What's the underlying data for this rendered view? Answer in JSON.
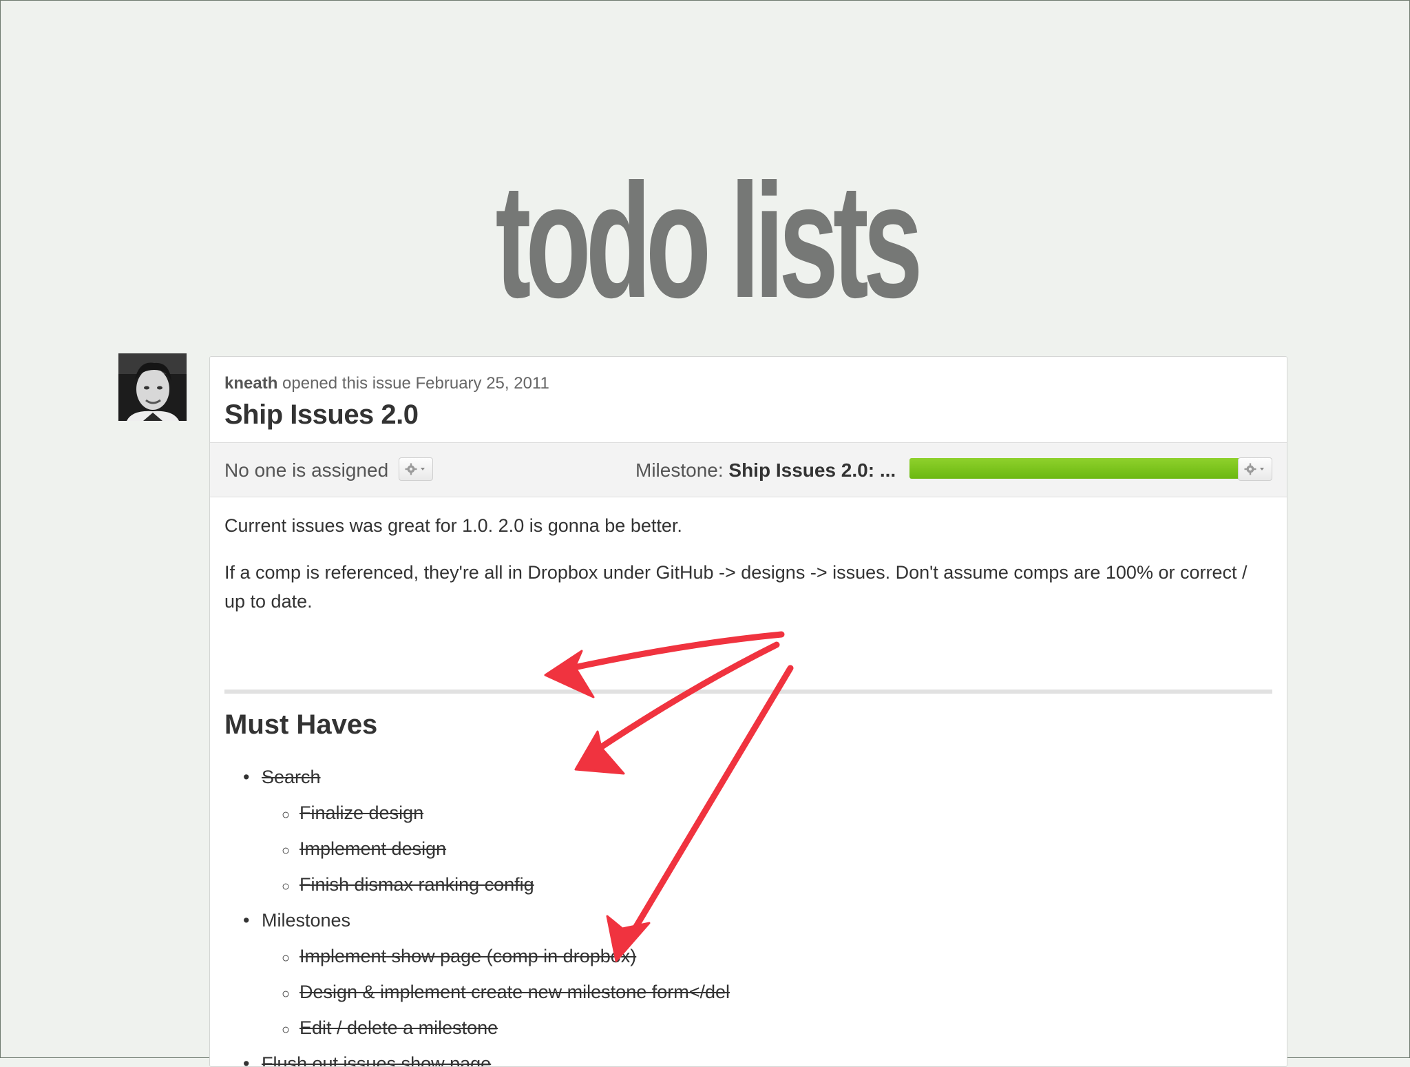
{
  "slide": {
    "title": "todo lists"
  },
  "issue": {
    "author": "kneath",
    "byline_rest": "opened this issue February 25, 2011",
    "title": "Ship Issues 2.0",
    "assignee_text": "No one is assigned",
    "milestone_prefix": "Milestone:",
    "milestone_name": "Ship Issues 2.0: ...",
    "milestone_progress": 1.0,
    "body_paragraph_1": "Current issues was great for 1.0. 2.0 is gonna be better.",
    "body_paragraph_2": "If a comp is referenced, they're all in Dropbox under GitHub -> designs -> issues. Don't assume comps are 100% or correct / up to date.",
    "section_heading": "Must Haves",
    "todos": [
      {
        "text": "Search",
        "level": 1,
        "done": true
      },
      {
        "text": "Finalize design",
        "level": 2,
        "done": true
      },
      {
        "text": "Implement design",
        "level": 2,
        "done": true
      },
      {
        "text": "Finish dismax ranking config",
        "level": 2,
        "done": true
      },
      {
        "text": "Milestones",
        "level": 1,
        "done": false
      },
      {
        "text": "Implement show page (comp in dropbox)",
        "level": 2,
        "done": true
      },
      {
        "text": "Design & implement create new milestone form</del",
        "level": 2,
        "done": true
      },
      {
        "text": "Edit / delete a milestone",
        "level": 2,
        "done": true
      },
      {
        "text": "Flush out issues show page",
        "level": 1,
        "done": true
      }
    ]
  },
  "colors": {
    "background": "#eff2ee",
    "title_gray": "#767876",
    "progress_green": "#77c11b",
    "annotation_red": "#f0333f"
  },
  "icons": {
    "assignee_menu": "gear-icon",
    "milestone_menu": "gear-icon"
  }
}
